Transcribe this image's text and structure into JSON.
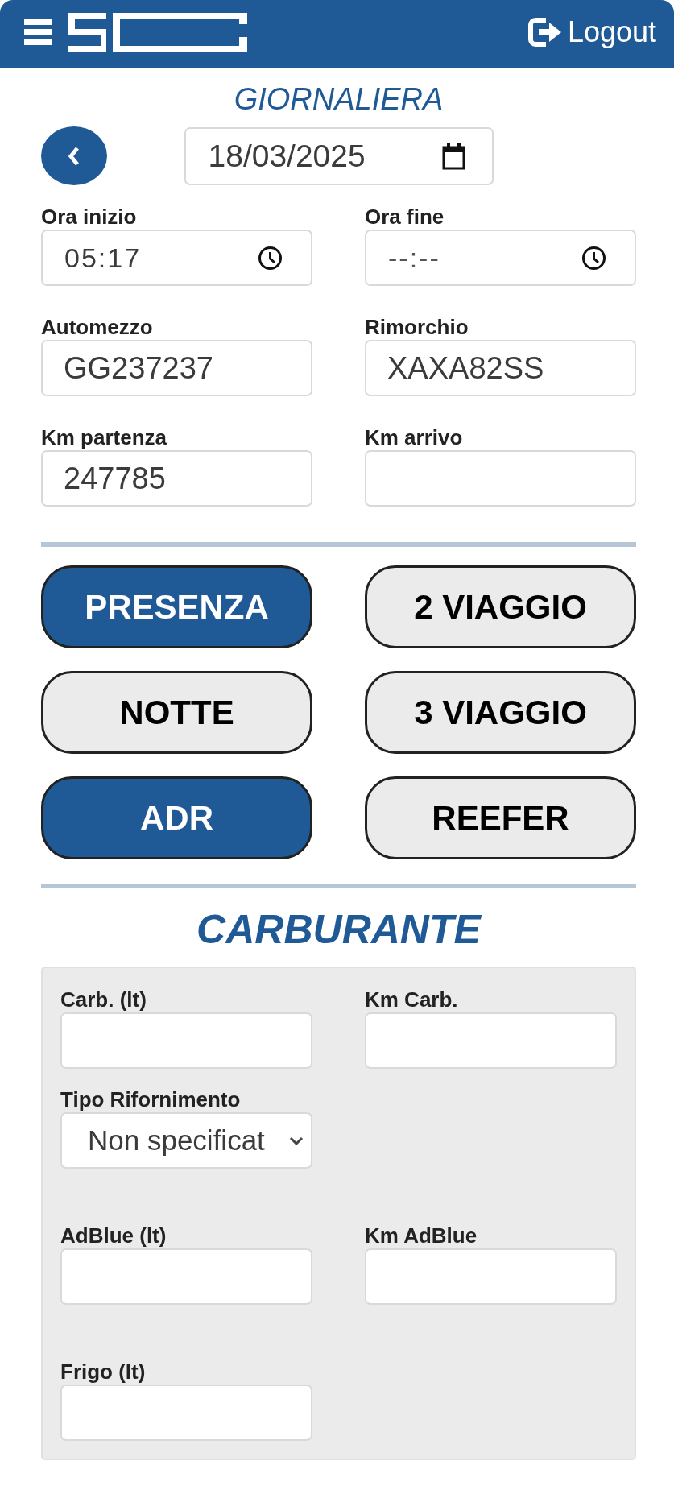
{
  "header": {
    "logout": "Logout"
  },
  "title": "GIORNALIERA",
  "date_field": {
    "value": "18/03/2025"
  },
  "fields": [
    {
      "label": "Ora inizio",
      "kind": "time",
      "value": "05:17"
    },
    {
      "label": "Ora fine",
      "kind": "time",
      "placeholder": "--:--"
    },
    {
      "label": "Automezzo",
      "kind": "text",
      "value": "GG237237"
    },
    {
      "label": "Rimorchio",
      "kind": "text",
      "value": "XAXA82SS"
    },
    {
      "label": "Km partenza",
      "kind": "text",
      "value": "247785"
    },
    {
      "label": "Km arrivo",
      "kind": "text"
    }
  ],
  "toggles": [
    {
      "label": "PRESENZA",
      "on": true
    },
    {
      "label": "2 VIAGGIO",
      "on": false
    },
    {
      "label": "NOTTE",
      "on": false
    },
    {
      "label": "3 VIAGGIO",
      "on": false
    },
    {
      "label": "ADR",
      "on": true
    },
    {
      "label": "REEFER",
      "on": false
    }
  ],
  "fuel": {
    "title": "CARBURANTE",
    "groups": [
      {
        "fields": [
          {
            "label": "Carb. (lt)",
            "kind": "text"
          },
          {
            "label": "Km Carb.",
            "kind": "text"
          },
          {
            "label": "Tipo Rifornimento",
            "kind": "select",
            "value": "Non specificat"
          }
        ]
      },
      {
        "fields": [
          {
            "label": "AdBlue (lt)",
            "kind": "text"
          },
          {
            "label": "Km AdBlue",
            "kind": "text"
          }
        ]
      },
      {
        "fields": [
          {
            "label": "Frigo (lt)",
            "kind": "text"
          }
        ]
      }
    ]
  }
}
